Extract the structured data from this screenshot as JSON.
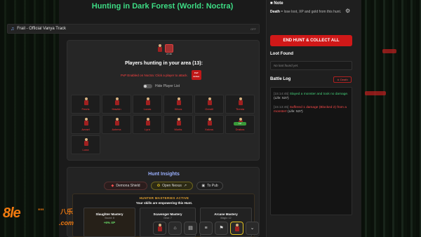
{
  "header": {
    "title": "Hunting in Dark Forest (World: Noctra)"
  },
  "music": {
    "track": "Frail - Official Vanya Track",
    "state": "OFF",
    "icon": "music-note-icon"
  },
  "players": {
    "heading": "Players hunting in your area (13):",
    "pvp_text": "PvP Enabled on Noctra: Click a player to attack.",
    "pvp_badge": "PvP Active",
    "hide_label": "Hide Player List",
    "me_level": "27-36",
    "list": [
      {
        "name": "Fenris"
      },
      {
        "name": "Hawkin"
      },
      {
        "name": "Lucas"
      },
      {
        "name": "Xilvos"
      },
      {
        "name": "Orestil"
      },
      {
        "name": "Tirenia"
      },
      {
        "name": "Azrael"
      },
      {
        "name": "Azterra"
      },
      {
        "name": "Lyra"
      },
      {
        "name": "Mortis"
      },
      {
        "name": "Xalvos"
      },
      {
        "name": "Drakos",
        "badge": "Lvl"
      },
      {
        "name": "Luna"
      }
    ]
  },
  "insights": {
    "title": "Hunt Insights",
    "buttons": [
      {
        "label": "Demona Shield"
      },
      {
        "label": "Open Nexus"
      },
      {
        "label": "To Pub"
      }
    ],
    "mastery_head": "HUNTER MASTERIES ACTIVE",
    "mastery_sub": "Your skills are empowering this Hunt.",
    "cards": [
      {
        "title": "Slaughter Mastery",
        "sub": "Sword: 8",
        "bonus": "+6% XP"
      },
      {
        "title": "Scavenger Mastery",
        "sub": "Gear: 7",
        "bonus": ""
      },
      {
        "title": "Arcane Mastery",
        "sub": "Magic: 12",
        "bonus": ""
      }
    ]
  },
  "side": {
    "note_title": "Note",
    "note_bold": "Death",
    "note_text": " = lose loot, XP and gold from this hunt.",
    "end_button": "END HUNT & COLLECT ALL",
    "loot_title": "Loot Found",
    "loot_empty": "No loot found yet.",
    "log_title": "Battle Log",
    "death_button": "Death",
    "log": [
      {
        "ts": "[15:14:45]",
        "text": "Slayed a monster and took no damage.",
        "life": "(Life: 537)",
        "color": "#45d07a"
      },
      {
        "ts": "[15:13:45]",
        "text": "Suffered 1 damage (Blocked 2) from a monster!",
        "life": "(Life: 537)",
        "color": "#ff4a4a"
      }
    ]
  },
  "bottom_bar": {
    "icons": [
      "home-icon",
      "inventory-icon",
      "menu-icon",
      "map-icon",
      "chevron-down-icon"
    ]
  },
  "watermark": {
    "big": "8le",
    "small": "\"\"",
    "cn": "八乐",
    "com": ".com"
  }
}
